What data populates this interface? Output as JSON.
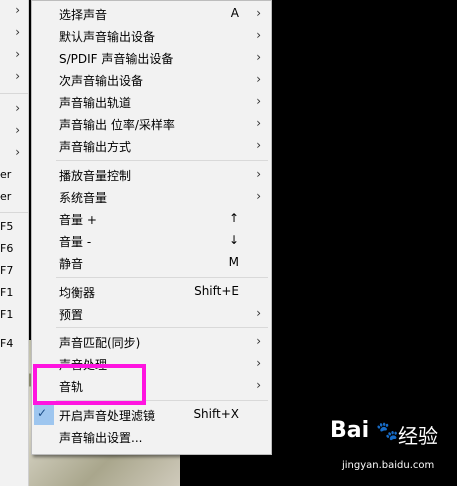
{
  "parent_menu": {
    "items": [
      {
        "text": "",
        "arrow": "›"
      },
      {
        "text": "",
        "arrow": "›"
      },
      {
        "text": "",
        "arrow": "›"
      },
      {
        "text": "",
        "arrow": "›"
      },
      {
        "text": "",
        "arrow": "›"
      },
      {
        "text": "",
        "arrow": "›"
      },
      {
        "text": "",
        "arrow": "›"
      },
      {
        "text": "er",
        "arrow": ""
      },
      {
        "text": "er",
        "arrow": ""
      },
      {
        "text": "F5",
        "arrow": ""
      },
      {
        "text": "F6",
        "arrow": ""
      },
      {
        "text": "F7",
        "arrow": ""
      },
      {
        "text": "F1",
        "arrow": ""
      },
      {
        "text": "F1",
        "arrow": ""
      },
      {
        "text": "F4",
        "arrow": ""
      }
    ]
  },
  "submenu": {
    "items": [
      {
        "label": "选择声音",
        "shortcut": "A",
        "arrow": "›"
      },
      {
        "label": "默认声音输出设备",
        "shortcut": "",
        "arrow": "›"
      },
      {
        "label": "S/PDIF 声音输出设备",
        "shortcut": "",
        "arrow": "›"
      },
      {
        "label": "次声音输出设备",
        "shortcut": "",
        "arrow": "›"
      },
      {
        "label": "声音输出轨道",
        "shortcut": "",
        "arrow": "›"
      },
      {
        "label": "声音输出 位率/采样率",
        "shortcut": "",
        "arrow": "›"
      },
      {
        "label": "声音输出方式",
        "shortcut": "",
        "arrow": "›"
      },
      {
        "label": "播放音量控制",
        "shortcut": "",
        "arrow": "›"
      },
      {
        "label": "系统音量",
        "shortcut": "",
        "arrow": "›"
      },
      {
        "label": "音量 +",
        "shortcut": "↑",
        "arrow": ""
      },
      {
        "label": "音量 -",
        "shortcut": "↓",
        "arrow": ""
      },
      {
        "label": "静音",
        "shortcut": "M",
        "arrow": ""
      },
      {
        "label": "均衡器",
        "shortcut": "Shift+E",
        "arrow": ""
      },
      {
        "label": "预置",
        "shortcut": "",
        "arrow": "›"
      },
      {
        "label": "声音匹配(同步)",
        "shortcut": "",
        "arrow": "›"
      },
      {
        "label": "声音处理",
        "shortcut": "",
        "arrow": "›"
      },
      {
        "label": "音轨",
        "shortcut": "",
        "arrow": "›"
      },
      {
        "label": "开启声音处理滤镜",
        "shortcut": "Shift+X",
        "arrow": "",
        "checked": "✓"
      },
      {
        "label": "声音输出设置...",
        "shortcut": "",
        "arrow": ""
      }
    ]
  },
  "watermark": {
    "logo": "Bai",
    "paw": "🐾",
    "brand": "经验",
    "domain": "jingyan.baidu.com"
  },
  "colors": {
    "highlight_border": "#ff14e0",
    "menu_bg": "#f2f2f2",
    "check_bg": "#9ec6ef"
  }
}
